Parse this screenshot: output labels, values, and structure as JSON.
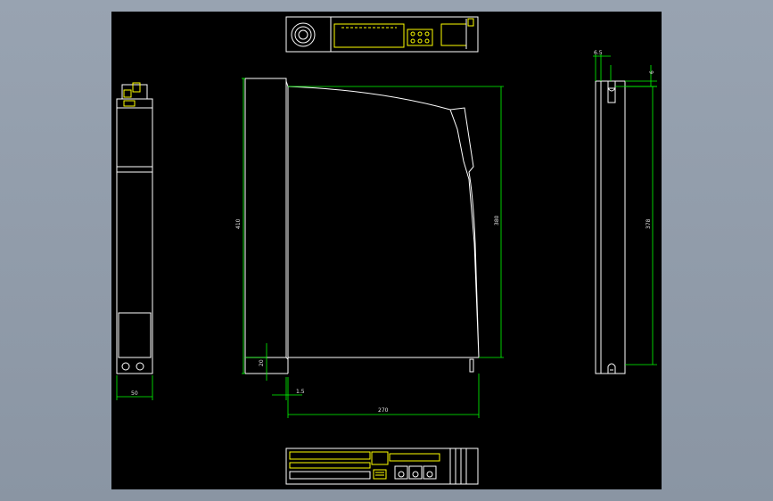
{
  "drawing": {
    "colors": {
      "background": "#000000",
      "outline": "#ffffff",
      "dimension": "#00ff00",
      "detail": "#ffff00",
      "frame": "#8f9aa8"
    },
    "dimensions": {
      "overall_height": "410",
      "body_height": "380",
      "side_height": "378",
      "side_offset": "6.5",
      "side_top_gap": "6",
      "base_height": "20",
      "base_offset": "1.5",
      "depth": "270",
      "width": "50"
    }
  }
}
